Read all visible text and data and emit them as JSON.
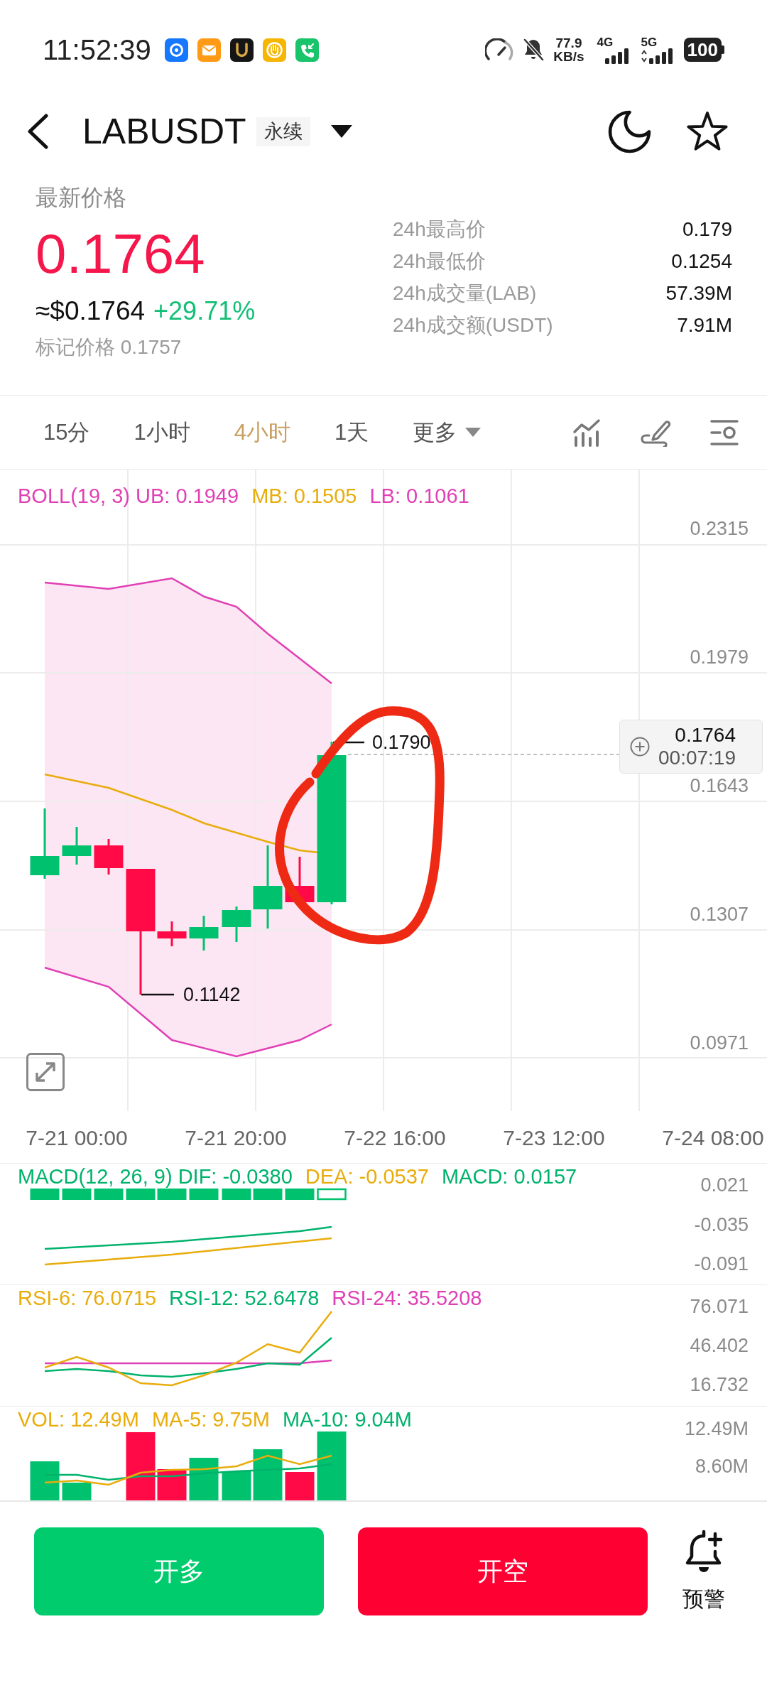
{
  "status_bar": {
    "time": "11:52:39",
    "network_speed": "77.9",
    "speed_unit": "KB/s",
    "networks": [
      {
        "type": "4G",
        "activity": false
      },
      {
        "type": "5G",
        "activity": true
      }
    ],
    "battery": "100"
  },
  "header": {
    "symbol": "LABUSDT",
    "contract_type": "永续"
  },
  "price": {
    "label": "最新价格",
    "last": "0.1764",
    "usd": "≈$0.1764",
    "change": "+29.71%",
    "mark": "标记价格 0.1757"
  },
  "stats": [
    {
      "label": "24h最高价",
      "value": "0.179"
    },
    {
      "label": "24h最低价",
      "value": "0.1254"
    },
    {
      "label": "24h成交量(LAB)",
      "value": "57.39M"
    },
    {
      "label": "24h成交额(USDT)",
      "value": "7.91M"
    }
  ],
  "intervals": [
    {
      "label": "15分",
      "selected": false
    },
    {
      "label": "1小时",
      "selected": false
    },
    {
      "label": "4小时",
      "selected": true
    },
    {
      "label": "1天",
      "selected": false
    }
  ],
  "more": {
    "label": "更多"
  },
  "main_chart": {
    "legend": [
      {
        "text": "BOLL(19, 3) UB: 0.1949",
        "color": "#e040b5"
      },
      {
        "text": "MB: 0.1505",
        "color": "#e8ac0c"
      },
      {
        "text": "LB: 0.1061",
        "color": "#e040b5"
      }
    ],
    "y_labels": [
      "0.2315",
      "0.1979",
      "0.1643",
      "0.1307",
      "0.0971"
    ],
    "high_label": "0.1790",
    "low_label": "0.1142",
    "current_price": "0.1764",
    "countdown": "00:07:19",
    "x_labels": [
      "7-21 00:00",
      "7-21 20:00",
      "7-22 16:00",
      "7-23 12:00",
      "7-24 08:00"
    ]
  },
  "macd": {
    "legend": [
      {
        "text": "MACD(12, 26, 9) DIF: -0.0380",
        "color": "#00b26b"
      },
      {
        "text": "DEA: -0.0537",
        "color": "#e8ac0c"
      },
      {
        "text": "MACD: 0.0157",
        "color": "#00b26b"
      }
    ],
    "y_labels": [
      "0.021",
      "-0.035",
      "-0.091"
    ]
  },
  "rsi": {
    "legend": [
      {
        "text": "RSI-6: 76.0715",
        "color": "#e8ac0c"
      },
      {
        "text": "RSI-12: 52.6478",
        "color": "#00b26b"
      },
      {
        "text": "RSI-24: 35.5208",
        "color": "#e040b5"
      }
    ],
    "y_labels": [
      "76.071",
      "46.402",
      "16.732"
    ]
  },
  "volume": {
    "legend": [
      {
        "text": "VOL: 12.49M",
        "color": "#e8ac0c"
      },
      {
        "text": "MA-5: 9.75M",
        "color": "#e8ac0c"
      },
      {
        "text": "MA-10: 9.04M",
        "color": "#00b26b"
      }
    ],
    "y_labels": [
      "12.49M",
      "8.60M"
    ]
  },
  "actions": [
    {
      "label": "开多",
      "kind": "long"
    },
    {
      "label": "开空",
      "kind": "short"
    }
  ],
  "alert": {
    "label": "预警"
  }
}
